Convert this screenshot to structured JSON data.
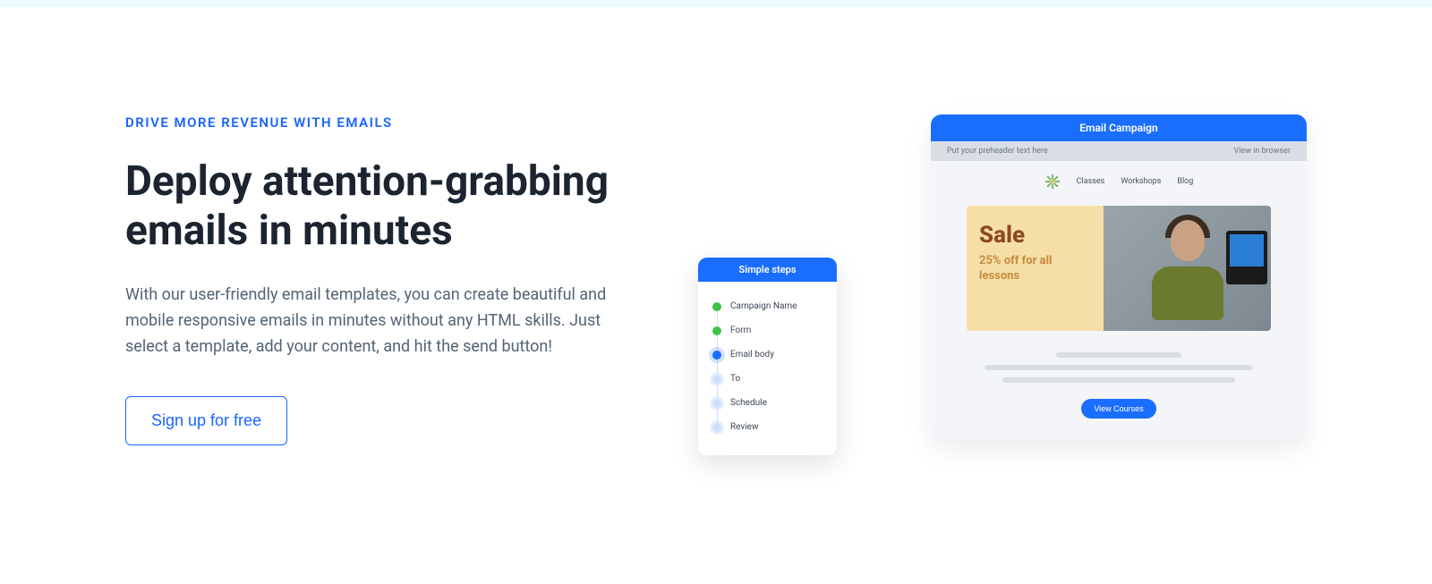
{
  "hero": {
    "eyebrow": "DRIVE MORE REVENUE WITH EMAILS",
    "headline": "Deploy attention-grabbing emails in minutes",
    "body": "With our user-friendly email templates, you can create beautiful and mobile responsive emails in minutes without any HTML skills. Just select a template, add your content, and hit the send button!",
    "cta": "Sign up for free"
  },
  "campaign": {
    "title": "Email Campaign",
    "preheader_placeholder": "Put your preheader text here",
    "view_browser": "View in browser",
    "nav": {
      "item1": "Classes",
      "item2": "Workshops",
      "item3": "Blog"
    },
    "sale_heading": "Sale",
    "sale_sub": "25% off for all lessons",
    "button": "View Courses"
  },
  "steps": {
    "title": "Simple steps",
    "items": {
      "0": "Campaign Name",
      "1": "Form",
      "2": "Email body",
      "3": "To",
      "4": "Schedule",
      "5": "Review"
    }
  }
}
